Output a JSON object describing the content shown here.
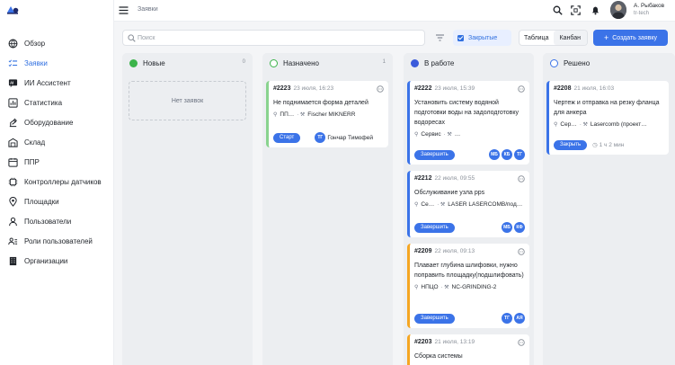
{
  "header": {
    "page_title": "Заявки",
    "user_name": "А. Рыбаков",
    "user_org": "tr-tech"
  },
  "sidebar": {
    "items": [
      {
        "label": "Обзор",
        "icon": "globe-icon"
      },
      {
        "label": "Заявки",
        "icon": "checklist-icon"
      },
      {
        "label": "ИИ Ассистент",
        "icon": "ai-chat-icon"
      },
      {
        "label": "Статистика",
        "icon": "chart-icon"
      },
      {
        "label": "Оборудование",
        "icon": "equipment-icon"
      },
      {
        "label": "Склад",
        "icon": "warehouse-icon"
      },
      {
        "label": "ППР",
        "icon": "calendar-icon"
      },
      {
        "label": "Контроллеры датчиков",
        "icon": "controller-icon"
      },
      {
        "label": "Площадки",
        "icon": "location-icon"
      },
      {
        "label": "Пользователи",
        "icon": "user-icon"
      },
      {
        "label": "Роли пользователей",
        "icon": "roles-icon"
      },
      {
        "label": "Организации",
        "icon": "building-icon"
      }
    ],
    "active_index": 1
  },
  "toolbar": {
    "search_placeholder": "Поиск",
    "closed_label": "Закрытые",
    "view_table": "Таблица",
    "view_kanban": "Канбан",
    "create_label": "Создать заявку"
  },
  "colors": {
    "accent": "#3b73e8",
    "new": "#3cb44b",
    "assigned": "#3cb44b",
    "in_progress": "#3b5bdb",
    "resolved": "#3b73e8",
    "bar_green": "#8ad38f",
    "bar_blue": "#3b73e8",
    "bar_orange": "#f5a623"
  },
  "columns": [
    {
      "title": "Новые",
      "count": "0",
      "empty_text": "Нет заявок",
      "cards": []
    },
    {
      "title": "Назначено",
      "count": "1",
      "cards": [
        {
          "number": "#2223",
          "date": "23 июля, 16:23",
          "description": "Не поднимается форма деталей",
          "site": "ПП…",
          "equipment": "Fischer MIKNERR",
          "action": "Старт",
          "avatars": [
            "ТГ"
          ],
          "assignee": "Гончар Тимофей"
        }
      ]
    },
    {
      "title": "В работе",
      "count": "",
      "cards": [
        {
          "number": "#2222",
          "date": "23 июля, 15:39",
          "description": "Установить систему водяной подготовки воды на задолодготовку водоресах",
          "site": "Сервис",
          "equipment": "…",
          "action": "Завершить",
          "avatars": [
            "МБ",
            "КБ",
            "ТГ"
          ]
        },
        {
          "number": "#2212",
          "date": "22 июля, 09:55",
          "description": "Обслуживание узла pps",
          "site": "Се…",
          "equipment": "LASER LASERCOMB/под…",
          "action": "Завершить",
          "avatars": [
            "МБ",
            "КФ"
          ]
        },
        {
          "number": "#2209",
          "date": "22 июля, 09:13",
          "description": "Плавает глубина шлифовки, нужно поправить площадку(подшлифовать)",
          "site": "НПЦО",
          "equipment": "NC-GRINDING-2",
          "action": "Завершить",
          "avatars": [
            "ТГ",
            "АЯ"
          ]
        },
        {
          "number": "#2203",
          "date": "21 июля, 13:19",
          "description": "Сборка системы"
        }
      ]
    },
    {
      "title": "Решено",
      "count": "",
      "cards": [
        {
          "number": "#2208",
          "date": "21 июля, 16:03",
          "description": "Чертеж и отправка на резку фланца для анкера",
          "site": "Сер…",
          "equipment": "Lasercomb (проект…",
          "action": "Закрыть",
          "timer": "1 ч 2 мин"
        }
      ]
    }
  ]
}
